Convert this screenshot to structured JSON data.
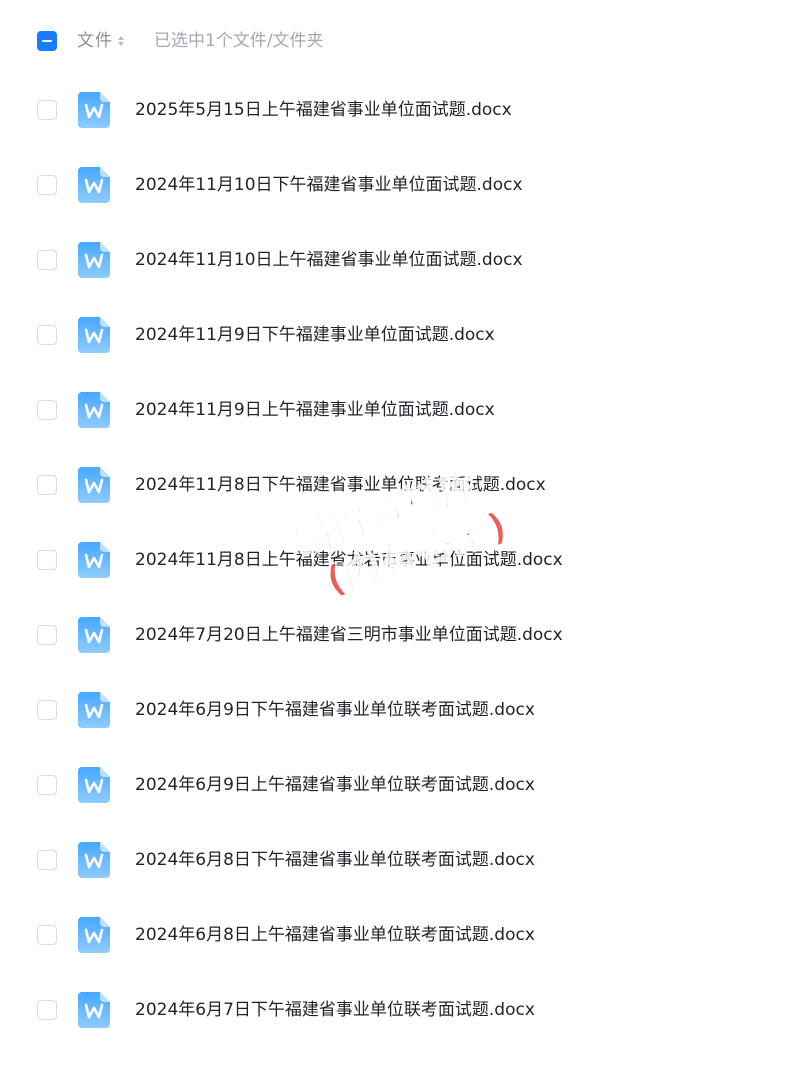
{
  "header": {
    "column_title": "文件",
    "sort_icon": "sort-updown-icon",
    "selection_status": "已选中1个文件/文件夹",
    "master_checkbox_state": "indeterminate"
  },
  "files": [
    {
      "name": "2025年5月15日上午福建省事业单位面试题.docx"
    },
    {
      "name": "2024年11月10日下午福建省事业单位面试题.docx"
    },
    {
      "name": "2024年11月10日上午福建省事业单位面试题.docx"
    },
    {
      "name": "2024年11月9日下午福建事业单位面试题.docx"
    },
    {
      "name": "2024年11月9日上午福建事业单位面试题.docx"
    },
    {
      "name": "2024年11月8日下午福建省事业单位联考面试题.docx"
    },
    {
      "name": "2024年11月8日上午福建省龙岩市事业单位面试题.docx"
    },
    {
      "name": "2024年7月20日上午福建省三明市事业单位面试题.docx"
    },
    {
      "name": "2024年6月9日下午福建省事业单位联考面试题.docx"
    },
    {
      "name": "2024年6月9日上午福建省事业单位联考面试题.docx"
    },
    {
      "name": "2024年6月8日下午福建省事业单位联考面试题.docx"
    },
    {
      "name": "2024年6月8日上午福建省事业单位联考面试题.docx"
    },
    {
      "name": "2024年6月7日下午福建省事业单位联考面试题.docx"
    }
  ],
  "file_icon": "word-document-icon",
  "watermark": {
    "line1": "猎得资料库",
    "line2": "(内有答案)"
  },
  "colors": {
    "accent": "#1a7cff",
    "icon_top": "#46a8ff",
    "icon_bottom": "#8fcbff",
    "text": "#1f2329",
    "muted": "#8a8f99",
    "checkbox_border": "#d9dce2",
    "watermark": "#e8413a"
  }
}
